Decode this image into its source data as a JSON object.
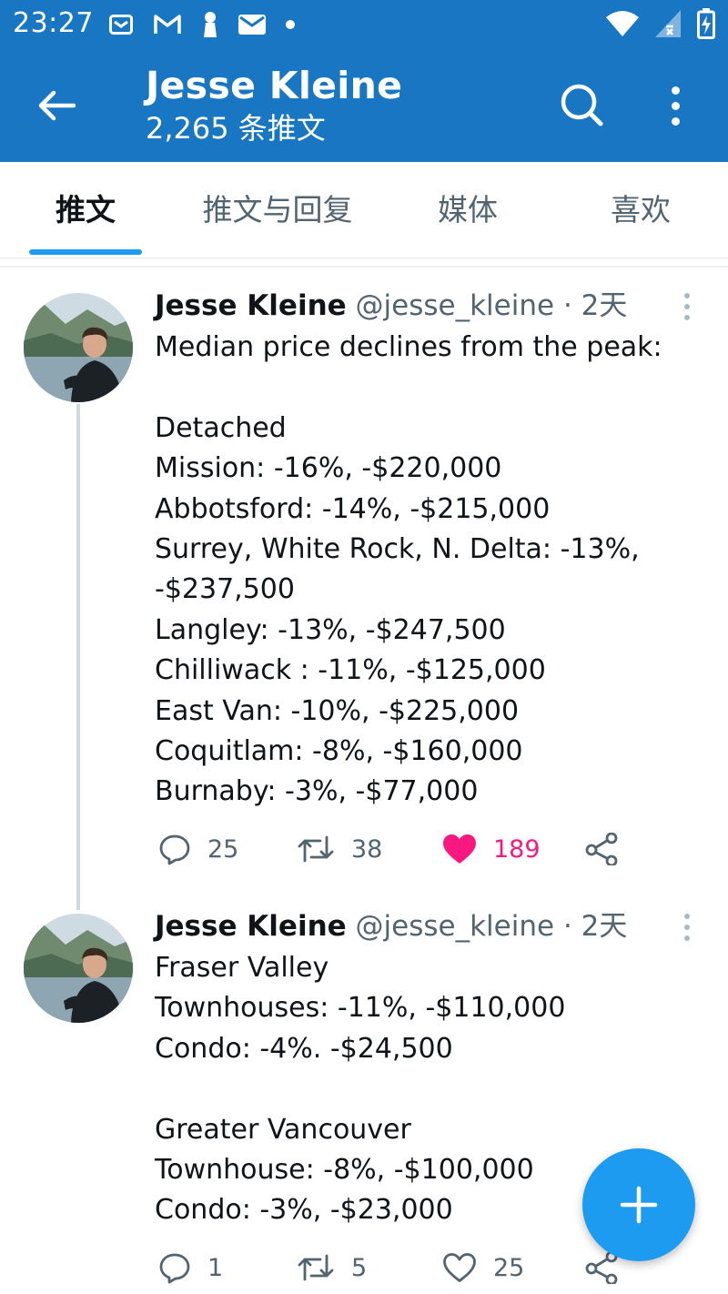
{
  "status_bar": {
    "time": "23:27",
    "notification_icons": [
      "mail-icon",
      "gmail-icon",
      "keyhole-icon",
      "message-icon",
      "dot-icon"
    ],
    "system_icons": [
      "wifi-icon",
      "signal-icon",
      "battery-icon"
    ]
  },
  "app_bar": {
    "title": "Jesse Kleine",
    "subtitle": "2,265 条推文",
    "color": "#1976c2"
  },
  "tabs": [
    {
      "label": "推文",
      "active": true
    },
    {
      "label": "推文与回复",
      "active": false
    },
    {
      "label": "媒体",
      "active": false
    },
    {
      "label": "喜欢",
      "active": false
    }
  ],
  "accent": "#1d9bf0",
  "like_color": "#f91880",
  "tweets": [
    {
      "name": "Jesse Kleine",
      "handle": "@jesse_kleine",
      "separator": "·",
      "time": "2天",
      "lines": [
        "Median price declines from the peak:",
        "",
        "Detached",
        "Mission: -16%, -$220,000",
        "Abbotsford: -14%, -$215,000",
        "Surrey, White Rock, N. Delta: -13%,",
        "-$237,500",
        "Langley: -13%, -$247,500",
        "Chilliwack : -11%, -$125,000",
        "East Van: -10%, -$225,000",
        "Coquitlam: -8%, -$160,000",
        "Burnaby: -3%, -$77,000"
      ],
      "replies": "25",
      "retweets": "38",
      "likes": "189",
      "liked": true
    },
    {
      "name": "Jesse Kleine",
      "handle": "@jesse_kleine",
      "separator": "·",
      "time": "2天",
      "lines": [
        "Fraser Valley",
        "Townhouses: -11%, -$110,000",
        "Condo: -4%. -$24,500",
        "",
        "Greater Vancouver",
        "Townhouse: -8%, -$100,000",
        "Condo: -3%, -$23,000"
      ],
      "replies": "1",
      "retweets": "5",
      "likes": "25",
      "liked": false
    }
  ]
}
